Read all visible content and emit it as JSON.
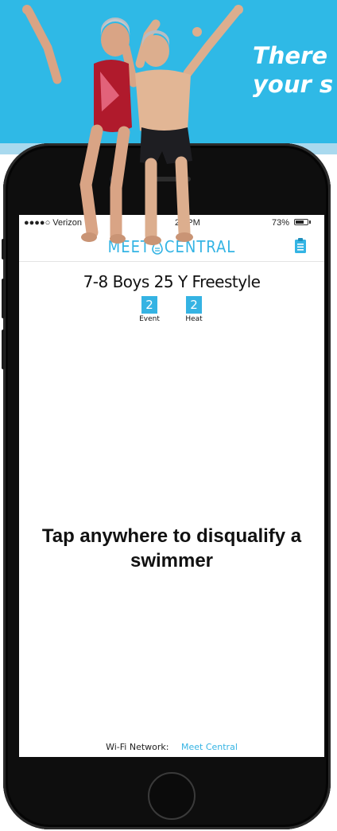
{
  "banner": {
    "headline_line1": "There",
    "headline_line2": "your s",
    "background_color": "#2fb9e6",
    "text_color": "#ffffff"
  },
  "status_bar": {
    "carrier": "●●●●○ Verizon",
    "time": "21 PM",
    "battery_percent": "73%",
    "battery_level": 0.73
  },
  "navbar": {
    "logo_left": "MEET",
    "logo_right": "CENTRAL",
    "logo_icon": "water-drop-icon",
    "action_icon": "clipboard-icon",
    "accent_color": "#34b4e4"
  },
  "event": {
    "title": "7-8 Boys 25 Y Freestyle",
    "event_number": "2",
    "event_label": "Event",
    "heat_number": "2",
    "heat_label": "Heat"
  },
  "main": {
    "instruction": "Tap anywhere to disqualify a swimmer"
  },
  "footer": {
    "wifi_label": "Wi-Fi Network:",
    "wifi_value": "Meet Central"
  },
  "device": {
    "home_button_icon": "home-button-icon"
  }
}
